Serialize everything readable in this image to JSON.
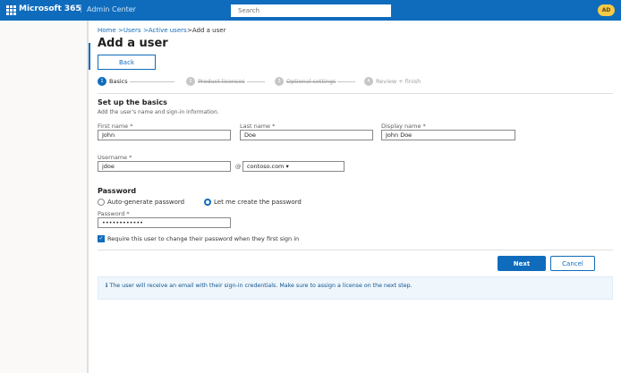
{
  "header": {
    "brand": "Microsoft 365",
    "separator": "|",
    "app": "Admin Center",
    "search_placeholder": "Search",
    "avatar": "AD"
  },
  "breadcrumb": [
    "Home",
    ">Users",
    ">Active users",
    ">Add a user"
  ],
  "page_title": "Add a user",
  "back_label": "Back",
  "steps": [
    {
      "num": "1",
      "label": "Basics"
    },
    {
      "num": "2",
      "label": "Product licenses"
    },
    {
      "num": "3",
      "label": "Optional settings"
    },
    {
      "num": "4",
      "label": "Review + finish"
    }
  ],
  "section": {
    "title": "Set up the basics",
    "subtitle": "Add the user's name and sign-in information."
  },
  "fields": {
    "first_name": {
      "label": "First name *",
      "value": "John"
    },
    "last_name": {
      "label": "Last name *",
      "value": "Doe"
    },
    "display_name": {
      "label": "Display name *",
      "value": "John Doe"
    },
    "username": {
      "label": "Username *",
      "value": "jdoe"
    },
    "at": "@",
    "domain": {
      "value": "contoso.com",
      "caret": "▾"
    }
  },
  "password": {
    "title": "Password",
    "auto_label": "Auto-generate password",
    "create_label": "Let me create the password",
    "field_label": "Password *",
    "value": "••••••••••••",
    "require_change_label": "Require this user to change their password when they first sign in",
    "check": "✓"
  },
  "actions": {
    "next": "Next",
    "cancel": "Cancel"
  },
  "info": {
    "icon": "ℹ",
    "text": "The user will receive an email with their sign-in credentials. Make sure to assign a license on the next step."
  }
}
